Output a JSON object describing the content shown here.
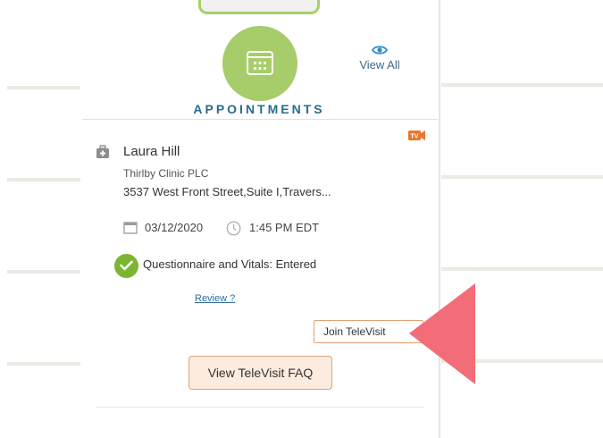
{
  "appointments": {
    "title": "APPOINTMENTS",
    "view_all_label": "View All",
    "card": {
      "patient_name": "Laura Hill",
      "clinic": "Thirlby Clinic PLC",
      "address": "3537 West Front Street,Suite I,Travers...",
      "date": "03/12/2020",
      "time": "1:45 PM EDT",
      "questionnaire_status": "Questionnaire and Vitals: Entered",
      "review_link": "Review ?",
      "join_button": "Join TeleVisit",
      "faq_button": "View TeleVisit FAQ",
      "televisit_badge": "TV"
    }
  },
  "colors": {
    "accent_green": "#a7cc6a",
    "check_green": "#7bb532",
    "title_blue": "#2b6c8a",
    "arrow_red": "#f26d78",
    "button_peach": "#fcebdf"
  },
  "icons": [
    "calendar-icon",
    "eye-icon",
    "medical-bag-icon",
    "calendar-small-icon",
    "clock-icon",
    "check-icon",
    "televisit-icon",
    "pointer-arrow-icon"
  ]
}
